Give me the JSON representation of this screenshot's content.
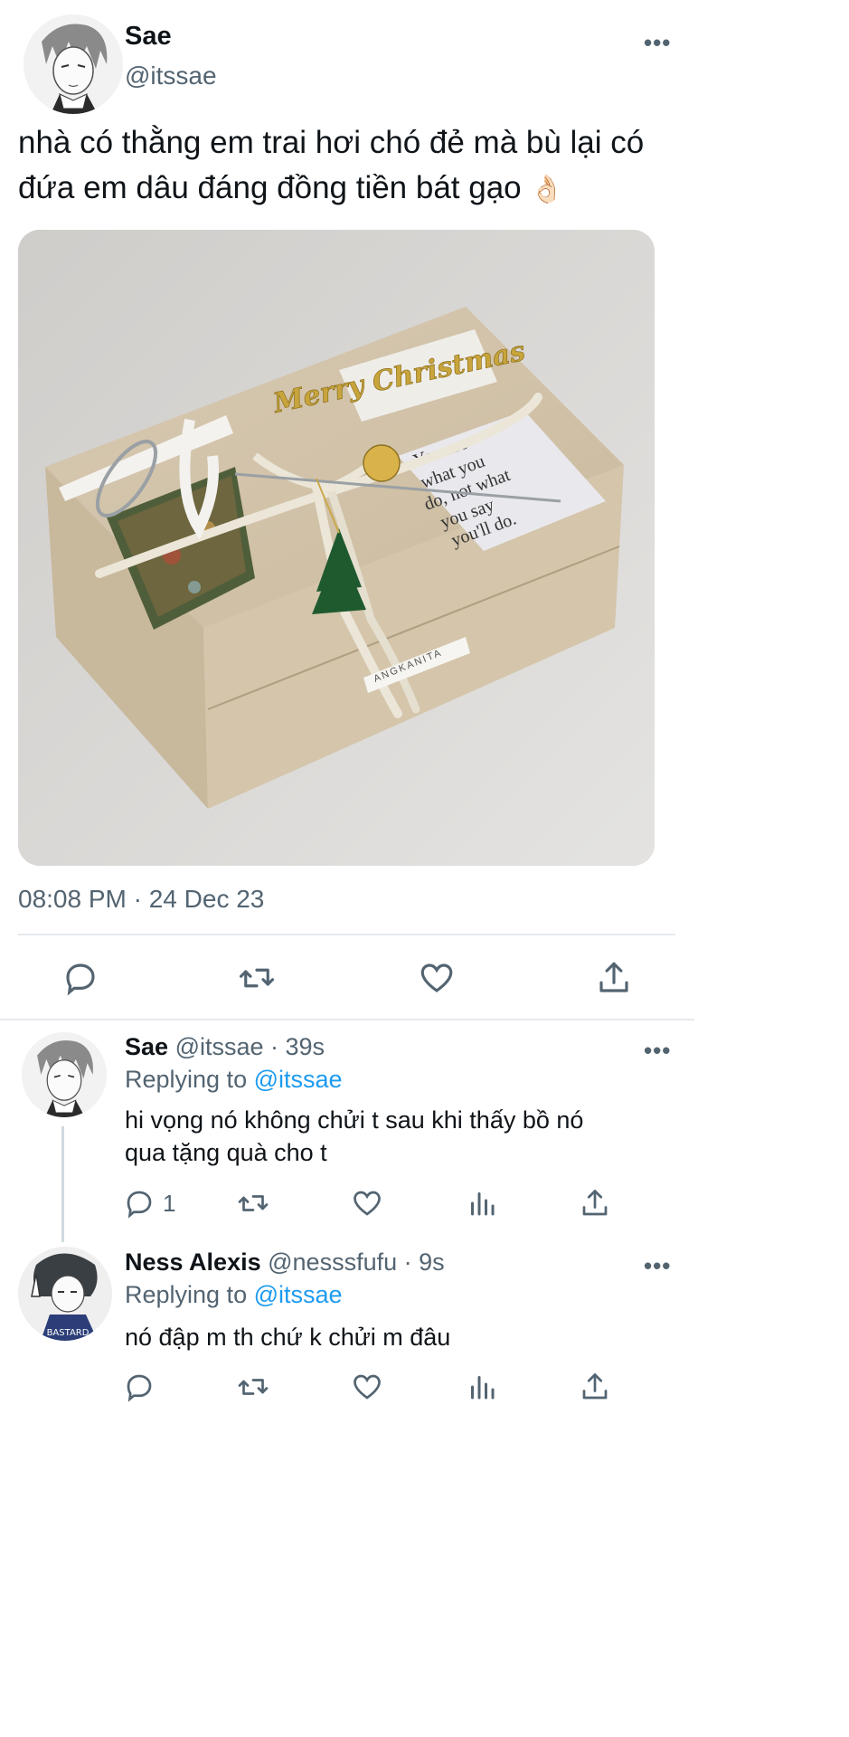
{
  "main_tweet": {
    "display_name": "Sae",
    "handle": "@itssae",
    "text_line1": "nhà có thằng em trai hơi chó đẻ mà bù lại có",
    "text_line2": "đứa em dâu đáng đồng tiền bát gạo",
    "emoji": "👌🏻",
    "timestamp": "08:08 PM · 24 Dec 23",
    "image_text": {
      "ornament": "Merry Christmas",
      "card": [
        "You are",
        "what you",
        "do, not what",
        "you say",
        "you'll do."
      ],
      "label": "ANGKANITA"
    }
  },
  "replies": [
    {
      "display_name": "Sae",
      "handle": "@itssae",
      "time": "· 39s",
      "replying_prefix": "Replying to",
      "replying_to": "@itssae",
      "text_line1": "hi vọng nó không chửi t sau khi thấy bồ nó",
      "text_line2": "qua tặng quà cho t",
      "reply_count": "1"
    },
    {
      "display_name": "Ness Alexis",
      "handle": "@nesssfufu",
      "time": "· 9s",
      "replying_prefix": "Replying to",
      "replying_to": "@itssae",
      "text_line1": "nó đập m th chứ k chửi m đâu",
      "reply_count": ""
    }
  ],
  "more_label": "•••",
  "colors": {
    "accent": "#1d9bf0",
    "muted": "#536471",
    "divider": "#e6e9ec"
  },
  "icons": [
    "reply-icon",
    "retweet-icon",
    "like-icon",
    "share-icon",
    "views-icon",
    "more-icon"
  ]
}
